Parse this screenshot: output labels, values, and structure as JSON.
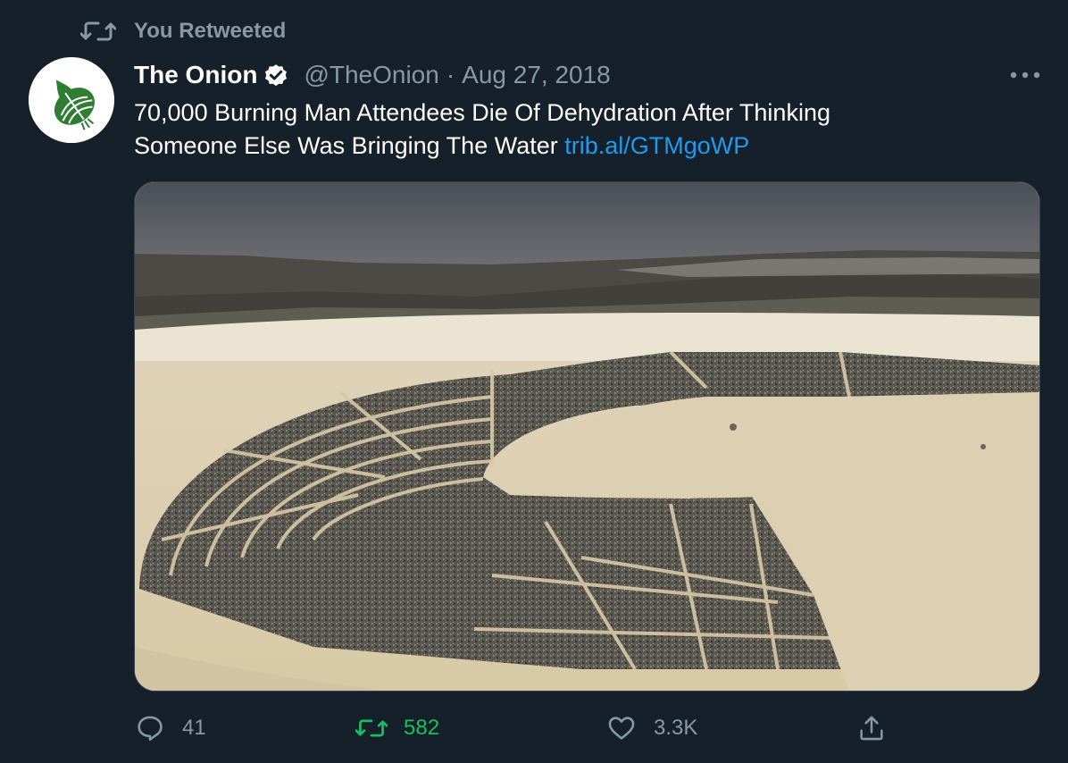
{
  "retweet_context": {
    "label": "You Retweeted",
    "icon": "retweet-icon"
  },
  "tweet": {
    "author": {
      "display_name": "The Onion",
      "verified": true,
      "handle": "@TheOnion",
      "avatar_icon": "onion-logo-icon"
    },
    "separator": "·",
    "date": "Aug 27, 2018",
    "text_line1": "70,000 Burning Man Attendees Die Of Dehydration After Thinking",
    "text_line2": "Someone Else Was Bringing The Water ",
    "link": "trib.al/GTMgoWP",
    "media": {
      "type": "photo",
      "icon": "aerial-photo-burning-man"
    },
    "actions": {
      "reply": {
        "icon": "reply-icon",
        "count": "41"
      },
      "retweet": {
        "icon": "retweet-icon",
        "count": "582",
        "active": true
      },
      "like": {
        "icon": "heart-icon",
        "count": "3.3K"
      },
      "share": {
        "icon": "share-icon"
      }
    }
  },
  "colors": {
    "background": "#15202b",
    "muted_text": "#8899a6",
    "link": "#1d9bf0",
    "retweeted_green": "#17bf63",
    "onion_green": "#2e7d32"
  }
}
